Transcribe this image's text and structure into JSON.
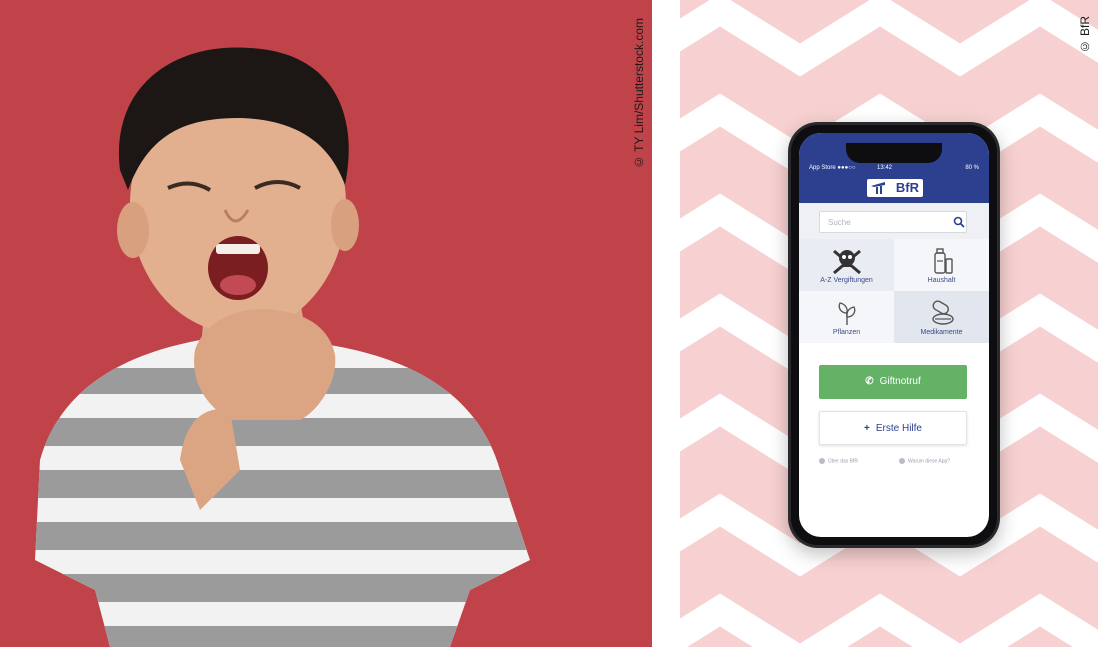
{
  "credits": {
    "left": "© TY Lim/Shutterstock.com",
    "right": "© BfR"
  },
  "colors": {
    "left_background": "#c0434a",
    "right_background": "#f7d1d1",
    "app_header": "#2d3f8f",
    "emergency_button": "#64b266"
  },
  "app": {
    "status_bar": {
      "carrier": "App Store ●●●○○",
      "time": "13:42",
      "battery": "80 %"
    },
    "logo": "BfR",
    "search": {
      "placeholder": "Suche"
    },
    "tiles": [
      {
        "label": "A-Z Vergiftungen",
        "icon": "skull-crossbones-icon"
      },
      {
        "label": "Haushalt",
        "icon": "household-bottle-icon"
      },
      {
        "label": "Pflanzen",
        "icon": "plant-leaf-icon"
      },
      {
        "label": "Medikamente",
        "icon": "pills-icon"
      }
    ],
    "buttons": {
      "giftnotruf": "Giftnotruf",
      "erste_hilfe": "Erste Hilfe"
    },
    "footer": {
      "uber_bfr": "Über das BfR",
      "warum_app": "Warum diese App?"
    }
  }
}
